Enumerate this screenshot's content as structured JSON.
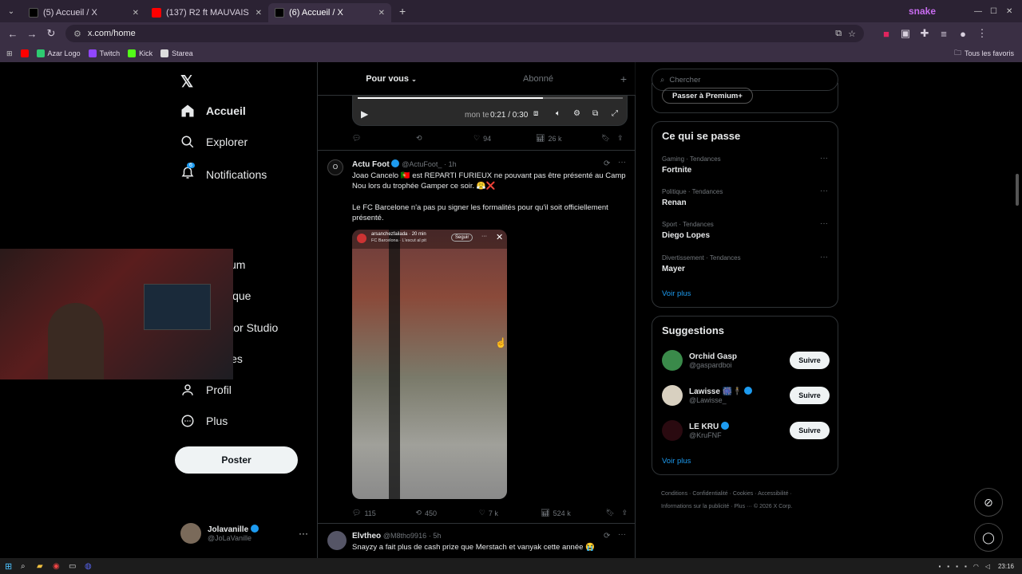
{
  "browser": {
    "tabs": [
      {
        "title": "(5) Accueil / X",
        "icon": "x-icon"
      },
      {
        "title": "(137) R2 ft MAUVAIS DJO - SO",
        "icon": "youtube-icon"
      },
      {
        "title": "(6) Accueil / X",
        "icon": "x-icon"
      }
    ],
    "url": "x.com/home",
    "bookmarks": [
      "Azar Logo",
      "Twitch",
      "Kick",
      "Starea"
    ],
    "all_bookmarks": "Tous les favoris",
    "brand_overlay": "snake"
  },
  "x": {
    "nav": [
      {
        "label": "Accueil",
        "icon": "home-icon"
      },
      {
        "label": "Explorer",
        "icon": "search-icon"
      },
      {
        "label": "Notifications",
        "icon": "bell-icon"
      },
      {
        "label": "um",
        "icon": ""
      },
      {
        "label": "ique",
        "icon": ""
      },
      {
        "label": "Creator Studio",
        "icon": "rocket-icon"
      },
      {
        "label": "Articles",
        "icon": "article-icon"
      },
      {
        "label": "Profil",
        "icon": "user-icon"
      },
      {
        "label": "Plus",
        "icon": "more-icon"
      }
    ],
    "notif_badge": "6",
    "post_button": "Poster",
    "me": {
      "name": "Jolavanille",
      "handle": "@JoLaVanille"
    },
    "feed_tabs": [
      "Pour vous",
      "Abonné"
    ],
    "video_player": {
      "time": "0:21 / 0:30",
      "overlay_text": "mon te"
    },
    "post1_stats": {
      "replies": "",
      "reposts": "",
      "likes": "94",
      "views": "26 k"
    },
    "post2": {
      "name": "Actu Foot",
      "handle": "@ActuFoot_",
      "time": "· 1h",
      "text1": "Joao Cancelo 🇵🇹 est REPARTI FURIEUX ne pouvant pas être présenté au Camp Nou lors du trophée Gamper ce soir. 😤❌",
      "text2": "Le FC Barcelone n'a pas pu signer les formalités pour qu'il soit officiellement présenté.",
      "story_user": "arsanchezfailada",
      "story_time": "20 min",
      "story_sub": "FC Barcelona · L'escut al pit",
      "story_follow": "Seguir",
      "stats": {
        "replies": "115",
        "reposts": "450",
        "likes": "7 k",
        "views": "524 k"
      }
    },
    "post3": {
      "name": "Elvtheo",
      "handle": "@M8tho9916",
      "time": "· 5h",
      "text": "Snayzy a fait plus de cash prize que Merstach et vanyak cette année 😭"
    },
    "search_placeholder": "Chercher",
    "premium_button": "Passer à Premium+",
    "trends_title": "Ce qui se passe",
    "trends": [
      {
        "category": "Gaming · Tendances",
        "name": "Fortnite"
      },
      {
        "category": "Politique · Tendances",
        "name": "Renan"
      },
      {
        "category": "Sport · Tendances",
        "name": "Diego Lopes"
      },
      {
        "category": "Divertissement · Tendances",
        "name": "Mayer"
      }
    ],
    "see_more": "Voir plus",
    "suggestions_title": "Suggestions",
    "suggestions": [
      {
        "name": "Orchid Gasp",
        "handle": "@gaspardboi",
        "verified": false
      },
      {
        "name": "Lawisse",
        "handle": "@Lawisse_",
        "verified": true
      },
      {
        "name": "LE KRU",
        "handle": "@KruFNF",
        "verified": true
      }
    ],
    "follow_label": "Suivre",
    "footer": {
      "line1": [
        "Conditions",
        "Confidentialité",
        "Cookies",
        "Accessibilité"
      ],
      "line2": [
        "Informations sur la publicité",
        "Plus ···",
        "© 2026 X Corp."
      ]
    }
  },
  "taskbar": {
    "time": "23:16"
  },
  "colors": {
    "accent": "#1d9bf0",
    "chrome": "#3a2f44",
    "border": "#2f3336"
  }
}
